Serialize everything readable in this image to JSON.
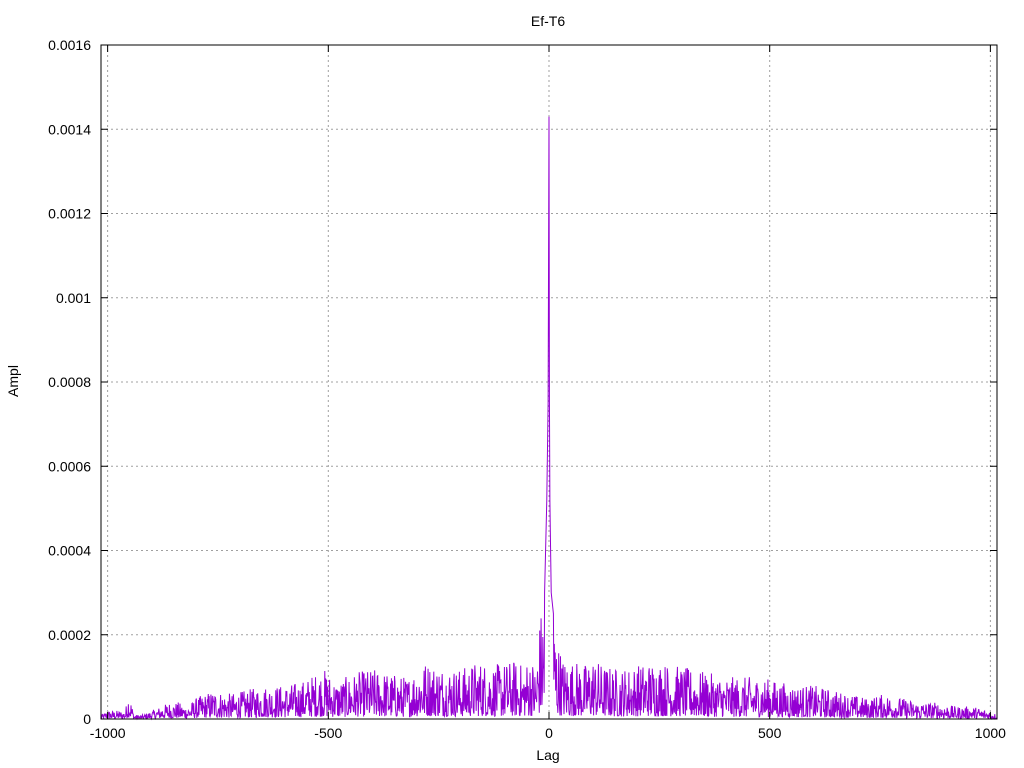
{
  "chart_data": {
    "type": "line",
    "title": "Ef-T6",
    "xlabel": "Lag",
    "ylabel": "Ampl",
    "xlim": [
      -1000,
      1000
    ],
    "ylim": [
      0,
      0.0016
    ],
    "xticks": [
      -1000,
      -500,
      0,
      500,
      1000
    ],
    "xtick_labels": [
      "-1000",
      "-500",
      "0",
      "500",
      "1000"
    ],
    "yticks": [
      0,
      0.0002,
      0.0004,
      0.0006,
      0.0008,
      0.001,
      0.0012,
      0.0014,
      0.0016
    ],
    "ytick_labels": [
      "0",
      "0.0002",
      "0.0004",
      "0.0006",
      "0.0008",
      "0.001",
      "0.0012",
      "0.0014",
      "0.0016"
    ],
    "grid": true,
    "legend": "none",
    "series": [
      {
        "color": "#9400d3",
        "description": "dense noisy autocorrelation trace; approximate envelope points (lag, amplitude)",
        "x": [
          -1015,
          -1000,
          -980,
          -960,
          -952,
          -940,
          -920,
          -900,
          -880,
          -860,
          -840,
          -820,
          -800,
          -780,
          -760,
          -720,
          -680,
          -650,
          -600,
          -560,
          -510,
          -480,
          -440,
          -400,
          -360,
          -320,
          -290,
          -250,
          -200,
          -160,
          -120,
          -80,
          -60,
          -40,
          -30,
          -20,
          -10,
          -5,
          -2,
          0,
          1,
          2,
          5,
          10,
          20,
          30,
          40,
          60,
          80,
          100,
          120,
          160,
          200,
          240,
          280,
          320,
          360,
          400,
          440,
          480,
          520,
          560,
          600,
          640,
          680,
          720,
          760,
          800,
          840,
          880,
          920,
          960,
          1000,
          1015
        ],
        "y": [
          1e-05,
          2e-05,
          2e-05,
          2e-05,
          7e-05,
          1e-05,
          1e-05,
          2e-05,
          3e-05,
          4e-05,
          4e-05,
          3e-05,
          5e-05,
          6e-05,
          7e-05,
          6e-05,
          7e-05,
          8e-05,
          8e-05,
          9e-05,
          0.00012,
          9e-05,
          0.00011,
          0.00012,
          0.00011,
          0.0001,
          0.00014,
          0.00013,
          0.00012,
          0.00014,
          0.00013,
          0.00014,
          0.00013,
          0.00015,
          0.00012,
          0.00025,
          0.0003,
          0.00052,
          0.00075,
          0.00143,
          0.00075,
          0.00052,
          0.0003,
          0.00025,
          0.00019,
          0.00015,
          0.00014,
          0.00014,
          0.00013,
          0.00015,
          0.00013,
          0.00012,
          0.00013,
          0.00014,
          0.00013,
          0.00012,
          0.00011,
          0.0001,
          0.0001,
          0.0001,
          9e-05,
          8e-05,
          8e-05,
          7e-05,
          6e-05,
          5e-05,
          6e-05,
          5e-05,
          4e-05,
          4e-05,
          3e-05,
          3e-05,
          2e-05,
          1e-05
        ]
      }
    ]
  }
}
